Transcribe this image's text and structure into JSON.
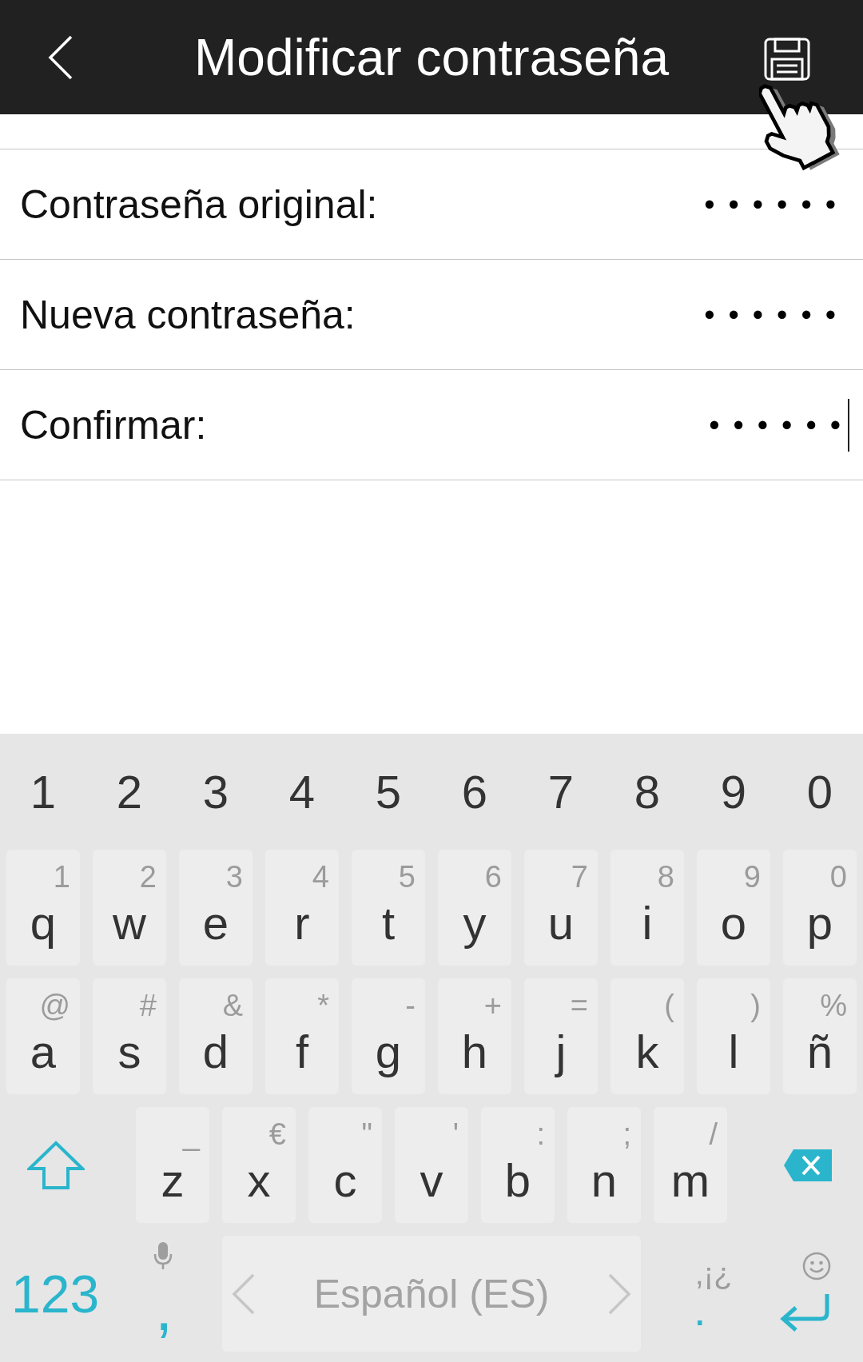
{
  "header": {
    "title": "Modificar contraseña"
  },
  "fields": [
    {
      "label": "Contraseña original:",
      "value": "••••••",
      "focused": false
    },
    {
      "label": "Nueva contraseña:",
      "value": "••••••",
      "focused": false
    },
    {
      "label": "Confirmar:",
      "value": "••••••",
      "focused": true
    }
  ],
  "keyboard": {
    "number_row": [
      "1",
      "2",
      "3",
      "4",
      "5",
      "6",
      "7",
      "8",
      "9",
      "0"
    ],
    "letter_rows": [
      [
        {
          "key": "q",
          "hint": "1"
        },
        {
          "key": "w",
          "hint": "2"
        },
        {
          "key": "e",
          "hint": "3"
        },
        {
          "key": "r",
          "hint": "4"
        },
        {
          "key": "t",
          "hint": "5"
        },
        {
          "key": "y",
          "hint": "6"
        },
        {
          "key": "u",
          "hint": "7"
        },
        {
          "key": "i",
          "hint": "8"
        },
        {
          "key": "o",
          "hint": "9"
        },
        {
          "key": "p",
          "hint": "0"
        }
      ],
      [
        {
          "key": "a",
          "hint": "@"
        },
        {
          "key": "s",
          "hint": "#"
        },
        {
          "key": "d",
          "hint": "&"
        },
        {
          "key": "f",
          "hint": "*"
        },
        {
          "key": "g",
          "hint": "-"
        },
        {
          "key": "h",
          "hint": "+"
        },
        {
          "key": "j",
          "hint": "="
        },
        {
          "key": "k",
          "hint": "("
        },
        {
          "key": "l",
          "hint": ")"
        },
        {
          "key": "ñ",
          "hint": "%"
        }
      ],
      [
        {
          "key": "z",
          "hint": "_"
        },
        {
          "key": "x",
          "hint": "€"
        },
        {
          "key": "c",
          "hint": "\""
        },
        {
          "key": "v",
          "hint": "'"
        },
        {
          "key": "b",
          "hint": ":"
        },
        {
          "key": "n",
          "hint": ";"
        },
        {
          "key": "m",
          "hint": "/"
        }
      ]
    ],
    "symbols_key": "123",
    "comma_key": ",",
    "space_label": "Español (ES)",
    "period_key": ".",
    "period_hint": ",¡¿"
  }
}
